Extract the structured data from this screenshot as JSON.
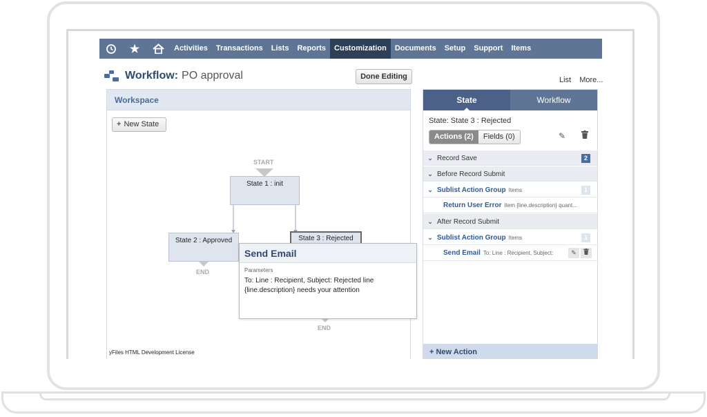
{
  "nav": {
    "icons": [
      "recent-icon",
      "star-icon",
      "home-icon"
    ],
    "items": [
      "Activities",
      "Transactions",
      "Lists",
      "Reports",
      "Customization",
      "Documents",
      "Setup",
      "Support",
      "Items"
    ],
    "active": "Customization"
  },
  "page": {
    "title_label": "Workflow:",
    "title_name": "PO approval",
    "done_button": "Done Editing",
    "link_list": "List",
    "link_more": "More..."
  },
  "workspace": {
    "header": "Workspace",
    "new_state": "New State",
    "start_label": "START",
    "end_label_1": "END",
    "end_label_2": "END",
    "states": [
      "State 1 : init",
      "State 2 : Approved",
      "State 3 : Rejected"
    ],
    "license": "yFiles HTML Development License"
  },
  "popup": {
    "title": "Send Email",
    "subtitle": "Parameters",
    "body": "To: Line : Recipient, Subject: Rejected line {line.description} needs your attention"
  },
  "panel": {
    "tabs": [
      "State",
      "Workflow"
    ],
    "state_label": "State: State 3 : Rejected",
    "actions_tab": "Actions (2)",
    "fields_tab": "Fields (0)",
    "record_save": "Record Save",
    "record_save_count": "2",
    "before_submit": "Before Record Submit",
    "group1": "Sublist Action Group",
    "group1_small": "Items",
    "group1_count": "1",
    "action1": "Return User Error",
    "action1_detail": "Item {line.description} quant...",
    "after_submit": "After Record Submit",
    "group2": "Sublist Action Group",
    "group2_small": "Items",
    "group2_count": "1",
    "action2": "Send Email",
    "action2_detail": "To: Line : Recipient, Subject:",
    "new_action": "New Action"
  }
}
